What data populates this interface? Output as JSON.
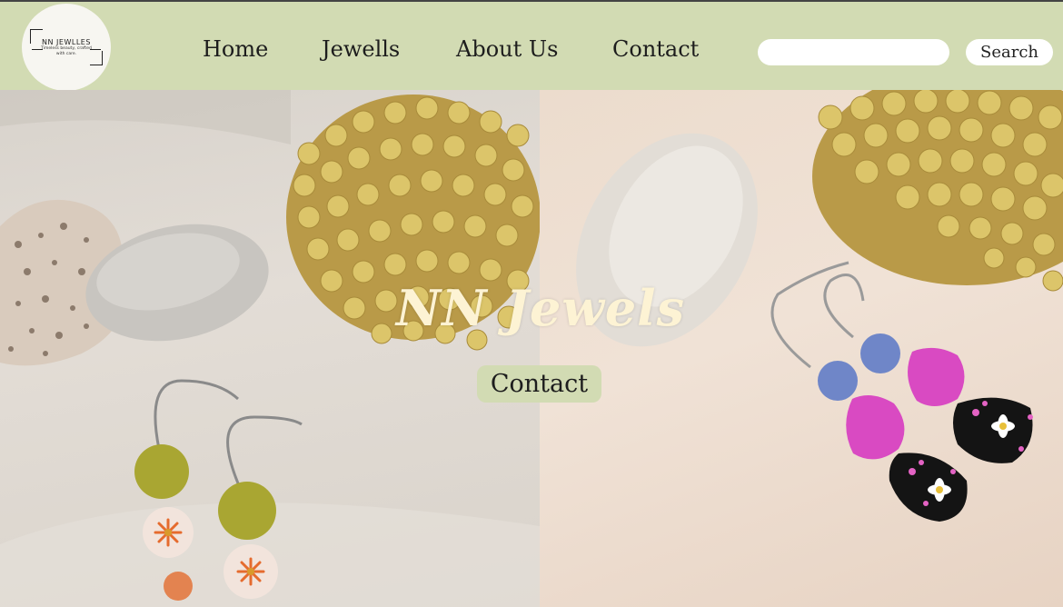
{
  "logo": {
    "name": "NN JEWLLES",
    "tagline": "Timeless beauty, crafted with care."
  },
  "nav": {
    "items": [
      {
        "label": "Home"
      },
      {
        "label": "Jewells"
      },
      {
        "label": "About Us"
      },
      {
        "label": "Contact"
      }
    ]
  },
  "search": {
    "placeholder": "",
    "value": "",
    "button_label": "Search"
  },
  "hero": {
    "title": "NN Jewels",
    "contact_button_label": "Contact"
  },
  "colors": {
    "header_bg": "#d2dbb3",
    "button_bg": "#d2dbb3",
    "title_color": "#fdf3d4"
  }
}
